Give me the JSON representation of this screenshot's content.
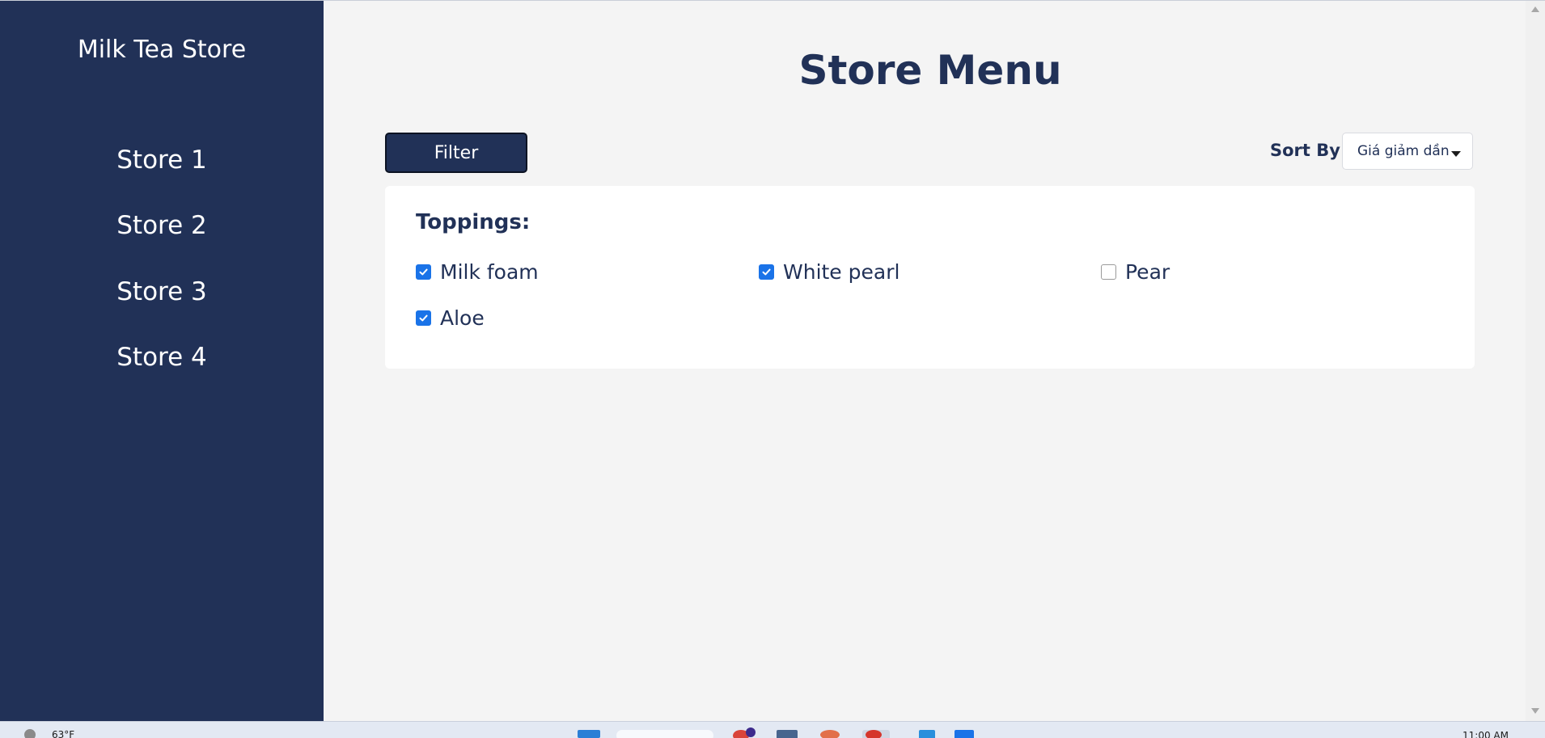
{
  "app": {
    "brand": "Milk Tea Store"
  },
  "sidebar": {
    "items": [
      {
        "label": "Store 1"
      },
      {
        "label": "Store 2"
      },
      {
        "label": "Store 3"
      },
      {
        "label": "Store 4"
      }
    ]
  },
  "main": {
    "title": "Store Menu",
    "filter_button": "Filter",
    "sort": {
      "label": "Sort By",
      "selected": "Giá giảm dần"
    },
    "toppings": {
      "title": "Toppings:",
      "options": [
        {
          "label": "Milk foam",
          "checked": true
        },
        {
          "label": "White pearl",
          "checked": true
        },
        {
          "label": "Pear",
          "checked": false
        },
        {
          "label": "Aloe",
          "checked": true
        }
      ]
    }
  },
  "taskbar": {
    "weather": "63°F",
    "clock": "11:00 AM"
  },
  "colors": {
    "sidebar_bg": "#213157",
    "accent": "#213157",
    "checkbox": "#1a73e8",
    "page_bg": "#f4f4f4"
  }
}
